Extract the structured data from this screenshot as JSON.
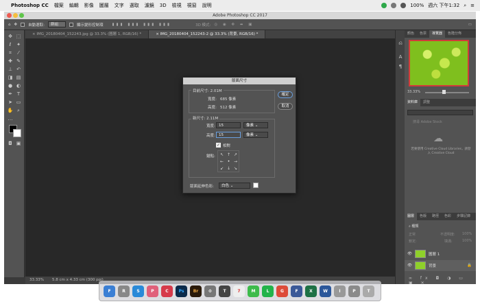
{
  "menubar": {
    "app_name": "Photoshop CC",
    "items": [
      "檔案",
      "編輯",
      "影像",
      "圖層",
      "文字",
      "選取",
      "濾鏡",
      "3D",
      "檢視",
      "視窗",
      "說明"
    ],
    "battery": "100%",
    "clock": "週六 下午1:32"
  },
  "window": {
    "title": "Adobe Photoshop CC 2017"
  },
  "options_bar": {
    "auto_select_label": "自動選取:",
    "auto_select_value": "群組",
    "transform_label": "顯示變形控制項",
    "mode_3d": "3D 模式:"
  },
  "doc_tabs": [
    {
      "label": "IMG_20180404_152243.jpg @ 33.3% (圖層 1, RGB/16) *",
      "active": false
    },
    {
      "label": "IMG_20180404_152243-2 @ 33.3% (背景, RGB/16) *",
      "active": true
    }
  ],
  "status": {
    "zoom": "33.33%",
    "size": "5.8 cm x 4.33 cm (300 ppi)"
  },
  "dialog": {
    "title": "版面尺寸",
    "current_size": "目前尺寸: 2.01M",
    "cur_width_label": "寬度:",
    "cur_width_value": "685 像素",
    "cur_height_label": "高度:",
    "cur_height_value": "512 像素",
    "new_size": "新尺寸: 2.11M",
    "width_label": "寬度:",
    "width_value": "15",
    "height_label": "高度:",
    "height_value": "15",
    "unit": "像素",
    "relative_label": "相對",
    "anchor_label": "錨點:",
    "ext_color_label": "版面延伸色彩:",
    "ext_color_value": "白色",
    "ok": "確定",
    "cancel": "取消"
  },
  "panels": {
    "top_tabs": [
      "顏色",
      "色票",
      "導覽器",
      "色階分佈"
    ],
    "zoom_value": "33.33%",
    "lib_tabs": [
      "資料庫",
      "調整"
    ],
    "lib_search": "搜尋 Adobe Stock",
    "cc_message": "若要使用 Creative Cloud Libraries，請登入 Creative Cloud",
    "layer_tabs": [
      "圖層",
      "色版",
      "路徑",
      "色彩",
      "步驟記錄"
    ],
    "kind_label": "種類",
    "blend_mode": "正常",
    "opacity_label": "不透明度:",
    "opacity_value": "100%",
    "lock_label": "鎖定:",
    "fill_label": "填滿:",
    "fill_value": "100%",
    "layers": [
      {
        "name": "圖層 1"
      },
      {
        "name": "背景"
      }
    ]
  },
  "dock_apps": [
    "F",
    "R",
    "S",
    "P",
    "C",
    "Ps",
    "Br",
    "⚙",
    "T",
    "7",
    "M",
    "L",
    "G",
    "F",
    "X",
    "W",
    "I",
    "P",
    "T"
  ],
  "colors": {
    "dialog_bg": "#535353",
    "canvas_bg": "#282828",
    "focus_blue": "#6aa0e0"
  }
}
